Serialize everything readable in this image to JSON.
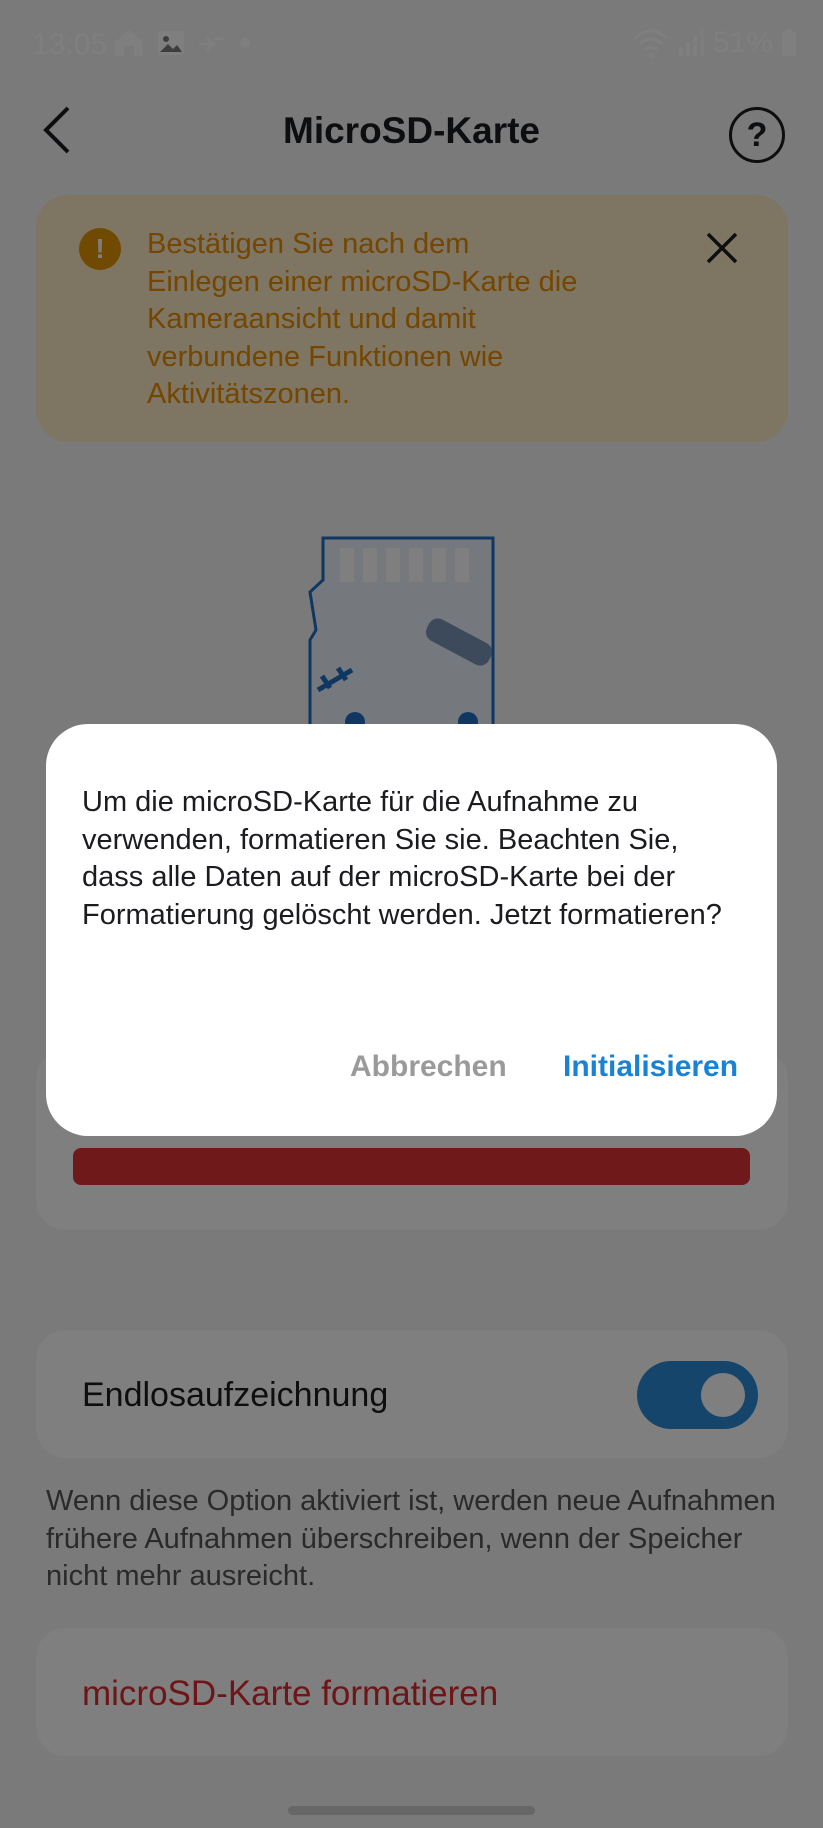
{
  "status_bar": {
    "time": "13:05",
    "battery": "51%"
  },
  "header": {
    "title": "MicroSD-Karte"
  },
  "banner": {
    "text": "Bestätigen Sie nach dem Einlegen einer microSD-Karte die Kameraansicht und damit verbundene Funktionen wie Aktivitätszonen."
  },
  "settings": {
    "loop_recording_label": "Endlosaufzeichnung",
    "loop_recording_enabled": true,
    "loop_recording_description": "Wenn diese Option aktiviert ist, werden neue Aufnahmen frühere Aufnahmen überschreiben, wenn der Speicher nicht mehr ausreicht.",
    "format_label": "microSD-Karte formatieren"
  },
  "dialog": {
    "message": "Um die microSD-Karte für die Aufnahme zu verwenden, formatieren Sie sie. Beachten Sie, dass alle Daten auf der microSD-Karte bei der Formatierung gelöscht werden. Jetzt formatieren?",
    "cancel_label": "Abbrechen",
    "confirm_label": "Initialisieren"
  },
  "colors": {
    "accent": "#1a82d2",
    "warning": "#e88d00",
    "danger": "#e02a2e"
  }
}
